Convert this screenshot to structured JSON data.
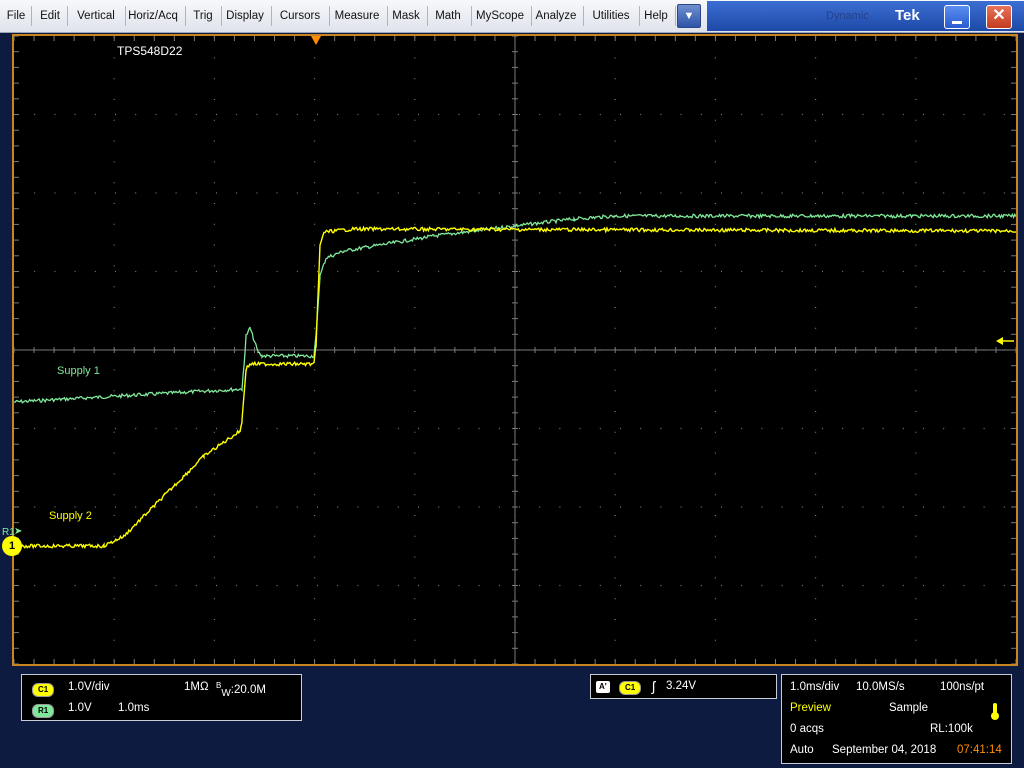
{
  "menu": {
    "items": [
      "File",
      "Edit",
      "Vertical",
      "Horiz/Acq",
      "Trig",
      "Display",
      "Cursors",
      "Measure",
      "Mask",
      "Math",
      "MyScope",
      "Analyze",
      "Utilities",
      "Help"
    ]
  },
  "titlebar": {
    "ghost_text": "Dynamic",
    "brand": "Tek",
    "close_glyph": "✕"
  },
  "screen": {
    "title": "TPS548D22",
    "supply1_label": "Supply 1",
    "supply2_label": "Supply 2",
    "ch1_marker": "1",
    "r1_marker": "R1"
  },
  "channel_panel": {
    "c1_badge": "C1",
    "c1_scale": "1.0V/div",
    "c1_impedance": "1MΩ",
    "c1_bw_prefix": "B",
    "c1_bw_sub": "W",
    "c1_bw_value": ":20.0M",
    "r1_badge": "R1",
    "r1_scale": "1.0V",
    "r1_time": "1.0ms"
  },
  "trigger_panel": {
    "mode_badge": "A'",
    "source_badge": "C1",
    "slope_glyph": "ʃ",
    "level": "3.24V"
  },
  "acq_panel": {
    "timebase": "1.0ms/div",
    "sample_rate": "10.0MS/s",
    "resolution": "100ns/pt",
    "mode": "Preview",
    "acq_type": "Sample",
    "acqs": "0 acqs",
    "record_length": "RL:100k",
    "trigger_mode": "Auto",
    "date": "September 04, 2018",
    "time": "07:41:14"
  },
  "colors": {
    "ch1": "#ffff00",
    "ref1": "#7fe89a",
    "graticule": "#7a7a7a",
    "frame": "#c88420",
    "accent_time": "#ff8c00"
  }
}
